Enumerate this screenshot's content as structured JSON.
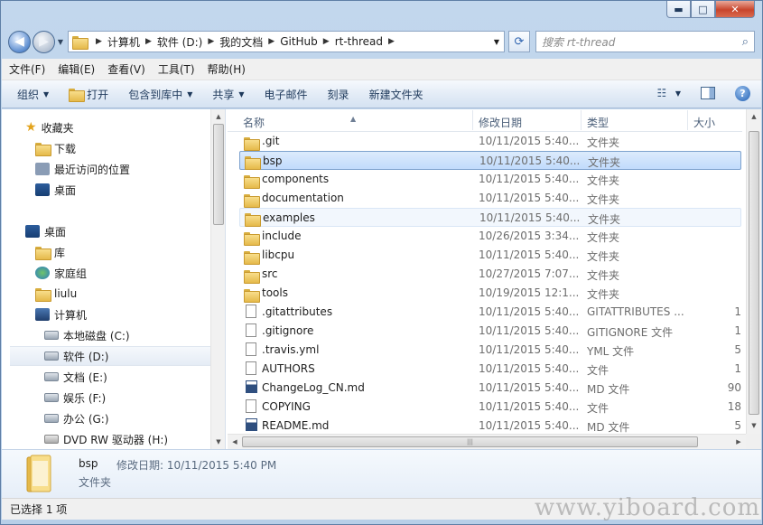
{
  "window": {
    "caption_buttons": [
      "▬",
      "□",
      "✕"
    ]
  },
  "address": {
    "crumbs": [
      "计算机",
      "软件 (D:)",
      "我的文档",
      "GitHub",
      "rt-thread"
    ],
    "search_placeholder": "搜索 rt-thread"
  },
  "menu": [
    "文件(F)",
    "编辑(E)",
    "查看(V)",
    "工具(T)",
    "帮助(H)"
  ],
  "commands": {
    "organize": "组织",
    "open": "打开",
    "include_library": "包含到库中",
    "share": "共享",
    "email": "电子邮件",
    "burn": "刻录",
    "new_folder": "新建文件夹"
  },
  "nav": {
    "favorites": "收藏夹",
    "downloads": "下载",
    "recent": "最近访问的位置",
    "desktop_fav": "桌面",
    "desktop": "桌面",
    "libraries": "库",
    "homegroup": "家庭组",
    "user": "liulu",
    "computer": "计算机",
    "drive_c": "本地磁盘 (C:)",
    "drive_d": "软件 (D:)",
    "drive_e": "文档 (E:)",
    "drive_f": "娱乐 (F:)",
    "drive_g": "办公 (G:)",
    "drive_h": "DVD RW 驱动器 (H:)"
  },
  "columns": {
    "name": "名称",
    "date": "修改日期",
    "type": "类型",
    "size": "大小"
  },
  "files": [
    {
      "name": ".git",
      "date": "10/11/2015 5:40...",
      "type": "文件夹",
      "size": "",
      "icon": "folder-icon"
    },
    {
      "name": "bsp",
      "date": "10/11/2015 5:40...",
      "type": "文件夹",
      "size": "",
      "icon": "folder-icon"
    },
    {
      "name": "components",
      "date": "10/11/2015 5:40...",
      "type": "文件夹",
      "size": "",
      "icon": "folder-icon"
    },
    {
      "name": "documentation",
      "date": "10/11/2015 5:40...",
      "type": "文件夹",
      "size": "",
      "icon": "folder-icon"
    },
    {
      "name": "examples",
      "date": "10/11/2015 5:40...",
      "type": "文件夹",
      "size": "",
      "icon": "folder-icon"
    },
    {
      "name": "include",
      "date": "10/26/2015 3:34...",
      "type": "文件夹",
      "size": "",
      "icon": "folder-icon"
    },
    {
      "name": "libcpu",
      "date": "10/11/2015 5:40...",
      "type": "文件夹",
      "size": "",
      "icon": "folder-icon"
    },
    {
      "name": "src",
      "date": "10/27/2015 7:07...",
      "type": "文件夹",
      "size": "",
      "icon": "folder-icon"
    },
    {
      "name": "tools",
      "date": "10/19/2015 12:1...",
      "type": "文件夹",
      "size": "",
      "icon": "folder-icon"
    },
    {
      "name": ".gitattributes",
      "date": "10/11/2015 5:40...",
      "type": "GITATTRIBUTES ...",
      "size": "1",
      "icon": "file-icon"
    },
    {
      "name": ".gitignore",
      "date": "10/11/2015 5:40...",
      "type": "GITIGNORE 文件",
      "size": "1",
      "icon": "file-icon"
    },
    {
      "name": ".travis.yml",
      "date": "10/11/2015 5:40...",
      "type": "YML 文件",
      "size": "5",
      "icon": "file-icon"
    },
    {
      "name": "AUTHORS",
      "date": "10/11/2015 5:40...",
      "type": "文件",
      "size": "1",
      "icon": "file-icon"
    },
    {
      "name": "ChangeLog_CN.md",
      "date": "10/11/2015 5:40...",
      "type": "MD 文件",
      "size": "90",
      "icon": "md-file-icon"
    },
    {
      "name": "COPYING",
      "date": "10/11/2015 5:40...",
      "type": "文件",
      "size": "18",
      "icon": "file-icon"
    },
    {
      "name": "README.md",
      "date": "10/11/2015 5:40...",
      "type": "MD 文件",
      "size": "5",
      "icon": "md-file-icon"
    }
  ],
  "details": {
    "name": "bsp",
    "modified": "修改日期: 10/11/2015 5:40 PM",
    "type": "文件夹"
  },
  "status": "已选择 1 项",
  "watermark": "www.yiboard.com"
}
